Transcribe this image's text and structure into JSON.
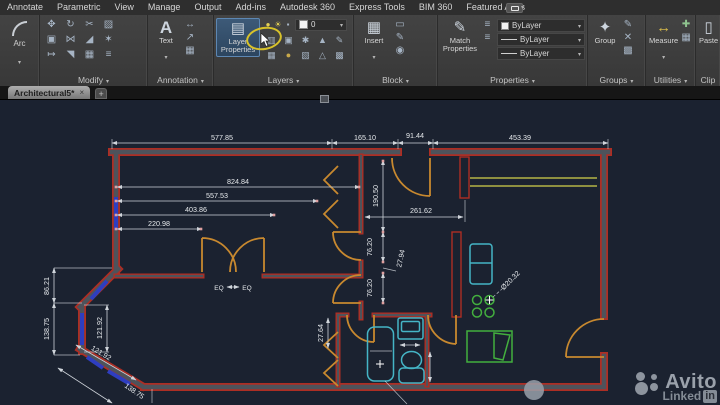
{
  "ribbon": {
    "tabs": [
      {
        "name": "tab-annotate",
        "label": "Annotate"
      },
      {
        "name": "tab-parametric",
        "label": "Parametric"
      },
      {
        "name": "tab-view",
        "label": "View"
      },
      {
        "name": "tab-manage",
        "label": "Manage"
      },
      {
        "name": "tab-output",
        "label": "Output"
      },
      {
        "name": "tab-add-ins",
        "label": "Add-ins"
      },
      {
        "name": "tab-autodesk-360",
        "label": "Autodesk 360"
      },
      {
        "name": "tab-express-tools",
        "label": "Express Tools"
      },
      {
        "name": "tab-bim-360",
        "label": "BIM 360"
      },
      {
        "name": "tab-featured-apps",
        "label": "Featured Apps"
      }
    ],
    "arc": {
      "label": "Arc"
    },
    "modify": {
      "label": "Modify",
      "icons": [
        {
          "name": "move-icon",
          "glyph": "✥"
        },
        {
          "name": "rotate-icon",
          "glyph": "↻"
        },
        {
          "name": "trim-icon",
          "glyph": "✂"
        },
        {
          "name": "erase-icon",
          "glyph": "▨"
        },
        {
          "name": "copy-icon",
          "glyph": "▣"
        },
        {
          "name": "mirror-icon",
          "glyph": "⋈"
        },
        {
          "name": "fillet-icon",
          "glyph": "◢"
        },
        {
          "name": "explode-icon",
          "glyph": "✶"
        },
        {
          "name": "stretch-icon",
          "glyph": "↦"
        },
        {
          "name": "scale-icon",
          "glyph": "◥"
        },
        {
          "name": "array-icon",
          "glyph": "▦"
        },
        {
          "name": "offset-icon",
          "glyph": "≡"
        }
      ]
    },
    "annotation": {
      "label": "Annotation",
      "big_glyph": "A",
      "big_label": "Text",
      "icons": [
        {
          "name": "linear-dimension-icon",
          "glyph": "↔"
        },
        {
          "name": "multileader-icon",
          "glyph": "↗"
        },
        {
          "name": "table-icon",
          "glyph": "▦"
        }
      ]
    },
    "layers": {
      "label": "Layers",
      "big_glyph": "▤",
      "big_label": "Layer Properties",
      "current_layer": "0",
      "top_icons": [
        {
          "name": "layer-on-bulb-icon",
          "glyph": "●",
          "color": "#e3cf55"
        },
        {
          "name": "layer-sun-icon",
          "glyph": "☀",
          "color": "#e3cf55"
        },
        {
          "name": "layer-state-icon",
          "glyph": "▪"
        }
      ],
      "grid_icons": [
        {
          "name": "layer-unsaved-icon",
          "glyph": "▥"
        },
        {
          "name": "layer-isolate-icon",
          "glyph": "▣"
        },
        {
          "name": "layer-freeze-icon",
          "glyph": "✱"
        },
        {
          "name": "layer-lock-icon",
          "glyph": "▲"
        },
        {
          "name": "layer-current-icon",
          "glyph": "✎"
        },
        {
          "name": "layer-walk-icon",
          "glyph": "▦"
        },
        {
          "name": "layer-off-icon",
          "glyph": "●",
          "color": "#c9a94a"
        },
        {
          "name": "layer-match-icon",
          "glyph": "▧"
        },
        {
          "name": "layer-unlock-icon",
          "glyph": "△"
        },
        {
          "name": "layer-merge-icon",
          "glyph": "▩"
        }
      ]
    },
    "block": {
      "label": "Block",
      "big_glyph": "▦",
      "big_label": "Insert",
      "icons": [
        {
          "name": "create-block-icon",
          "glyph": "▭"
        },
        {
          "name": "edit-block-icon",
          "glyph": "✎"
        },
        {
          "name": "block-attributes-icon",
          "glyph": "◉"
        }
      ]
    },
    "properties": {
      "label": "Properties",
      "big_glyph": "✎",
      "big_label": "Match Properties",
      "bylayer": "ByLayer",
      "side_icons": [
        {
          "name": "linetype-list-icon",
          "glyph": "≡"
        },
        {
          "name": "lineweight-list-icon",
          "glyph": "≡"
        }
      ]
    },
    "groups": {
      "label": "Groups",
      "big_glyph": "✦",
      "big_label": "Group",
      "icons": [
        {
          "name": "group-edit-icon",
          "glyph": "✎"
        },
        {
          "name": "ungroup-icon",
          "glyph": "✕"
        },
        {
          "name": "group-selection-icon",
          "glyph": "▩"
        }
      ]
    },
    "utilities": {
      "label": "Utilities",
      "big_glyph": "↔",
      "big_label": "Measure",
      "icons": [
        {
          "name": "id-point-icon",
          "glyph": "✚",
          "color": "#8fc48f"
        },
        {
          "name": "quick-calc-icon",
          "glyph": "▦"
        }
      ]
    },
    "clipboard": {
      "label": "Clip",
      "big_glyph": "▯",
      "big_label": "Paste"
    }
  },
  "document_tabs": {
    "active_tab": "Architectural5*",
    "close_glyph": "×",
    "new_tab_glyph": "+"
  },
  "plan": {
    "dims": {
      "top_room": "577.85",
      "top_mid": "165.10",
      "top_door": "91.44",
      "top_right": "453.39",
      "int_1": "824.84",
      "int_2": "557.53",
      "int_3": "403.86",
      "int_4": "220.98",
      "wall_a": "190.50",
      "right_room": "261.62",
      "door_1": "76.20",
      "stub": "27.94",
      "door_2": "76.20",
      "bath": "27.64",
      "bay_1": "86.21",
      "bay_2": "138.75",
      "bay_3": "121.92",
      "bay_4": "121.92",
      "bay_5": "138.75",
      "burner": "Ø20.32",
      "eq_left": "EQ",
      "eq_right": "EQ"
    }
  },
  "watermark": {
    "brand": "Avito",
    "linked_text": "Linked",
    "in_badge": "in"
  },
  "colors": {
    "canvas_bg": "#1b2230",
    "wall_red": "#ad2e24",
    "wall_core": "#4e535b",
    "door_orange": "#c8892f",
    "window_blue": "#2e3ec0",
    "fixture_cyan": "#45b5c6",
    "kitchen_green": "#43af3e",
    "window_yellow": "#b5b546",
    "dim_white": "#dfe3e8",
    "highlight_yellow": "#d8c22a",
    "layer_button_blue": "#3d5a78"
  }
}
